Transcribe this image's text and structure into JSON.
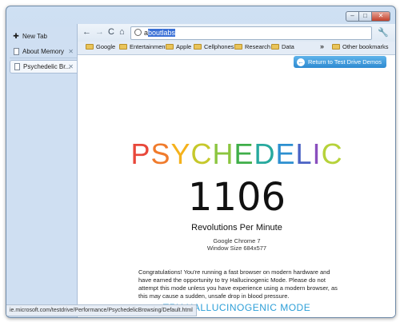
{
  "window": {
    "controls": {
      "minimize": "–",
      "maximize": "□",
      "close": "✕"
    }
  },
  "sidebar": {
    "new_tab_label": "New Tab",
    "tabs": [
      {
        "label": "About Memory",
        "close": "✕"
      },
      {
        "label": "Psychedelic Br...",
        "close": "✕"
      }
    ]
  },
  "toolbar": {
    "back": "←",
    "forward": "→",
    "reload": "C",
    "home": "⌂",
    "url_prefix": "a",
    "url_selected": "boutlabs",
    "wrench": "🔧"
  },
  "bookmarks": {
    "items": [
      "Google",
      "Entertainment",
      "Apple",
      "Cellphones",
      "Research",
      "Data"
    ],
    "overflow": "»",
    "other": "Other bookmarks"
  },
  "page": {
    "return_button": "Return to Test Drive Demos",
    "title_letters": [
      {
        "ch": "P",
        "color": "#e8473a"
      },
      {
        "ch": "S",
        "color": "#f07b2c"
      },
      {
        "ch": "Y",
        "color": "#f5b21c"
      },
      {
        "ch": "C",
        "color": "#c6c82b"
      },
      {
        "ch": "H",
        "color": "#8bc53f"
      },
      {
        "ch": "E",
        "color": "#3fae49"
      },
      {
        "ch": "D",
        "color": "#27a99e"
      },
      {
        "ch": "E",
        "color": "#2c8fd0"
      },
      {
        "ch": "L",
        "color": "#4a62c4"
      },
      {
        "ch": "I",
        "color": "#8a4fbe"
      },
      {
        "ch": "C",
        "color": "#b6d23a"
      }
    ],
    "rpm_value": "1106",
    "rpm_label": "Revolutions Per Minute",
    "browser_name": "Google Chrome 7",
    "window_size": "Window Size 684x577",
    "congrats_text": "Congratulations! You're running a fast browser on modern hardware and have earned the opportunity to try Hallucinogenic Mode. Please do not attempt this mode unless you have experience using a modern browser, as this may cause a sudden, unsafe drop in blood pressure.",
    "try_link": "TRY HALLUCINOGENIC MODE"
  },
  "status_bar": "ie.microsoft.com/testdrive/Performance/PsychedelicBrowsing/Default.html"
}
